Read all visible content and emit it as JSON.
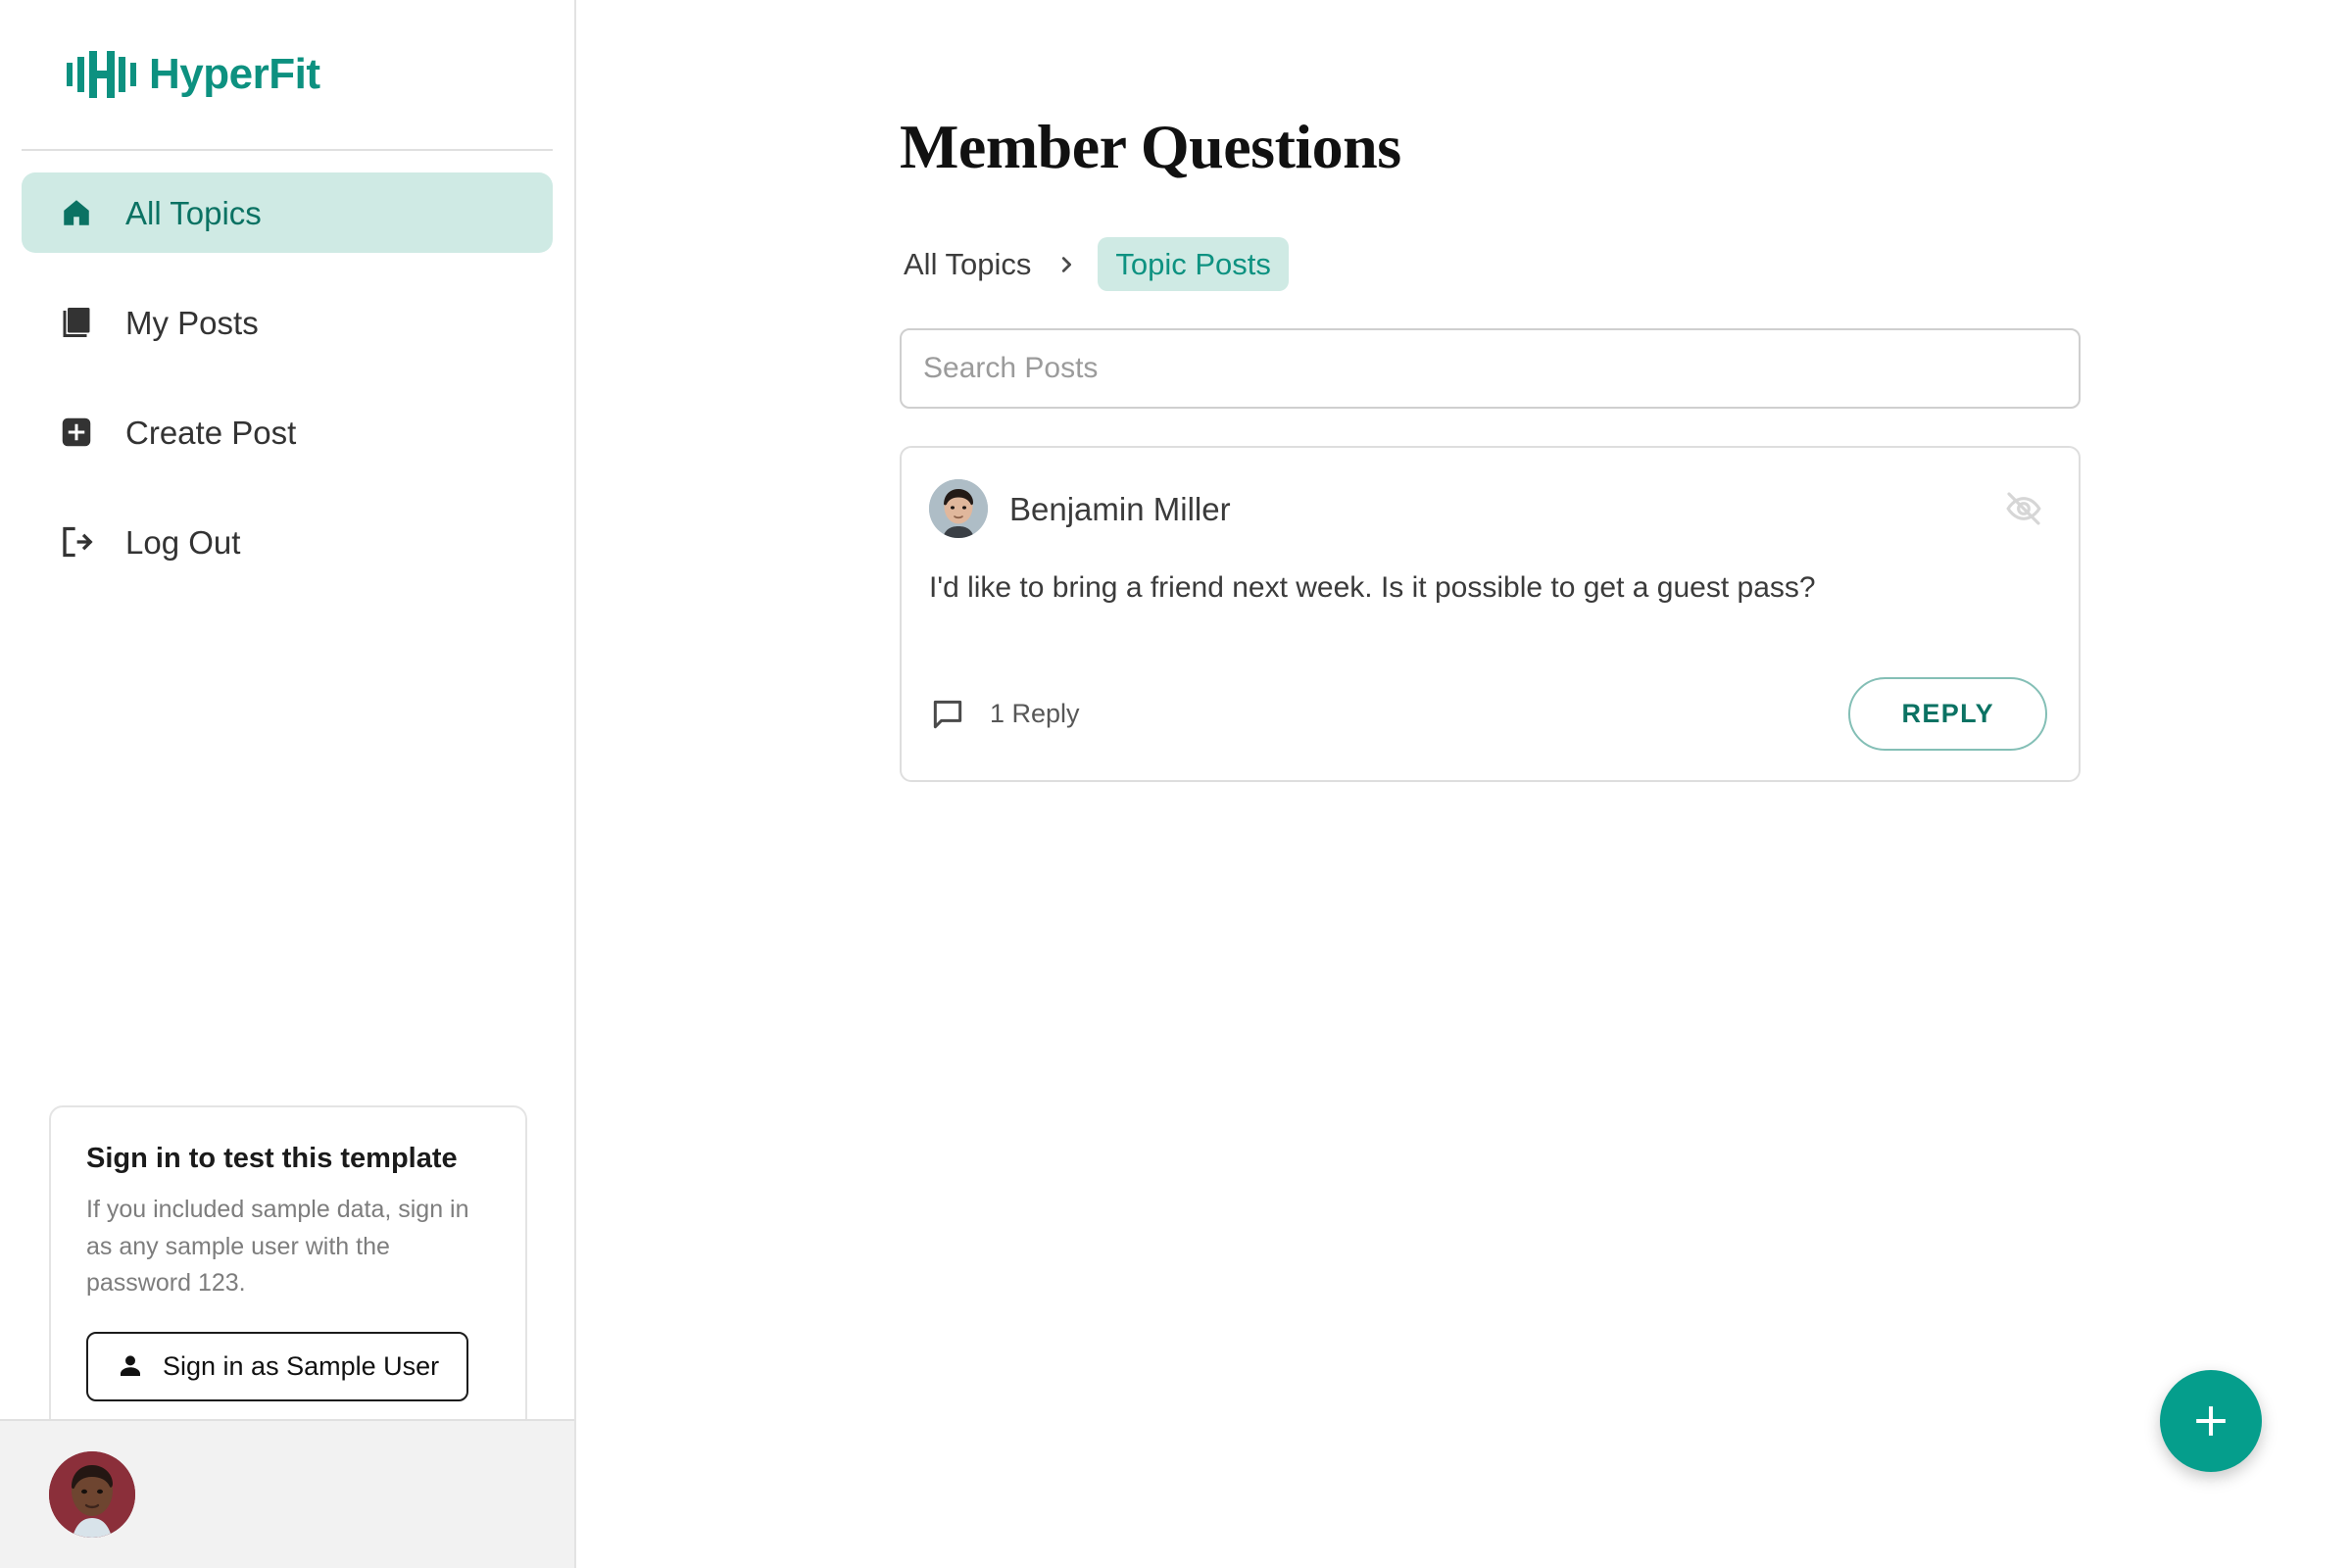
{
  "brand": {
    "name": "HyperFit",
    "logo_icon": "barbell-icon",
    "color": "#0d9180"
  },
  "sidebar": {
    "items": [
      {
        "label": "All Topics",
        "icon": "home-icon",
        "active": true
      },
      {
        "label": "My Posts",
        "icon": "library-books-icon",
        "active": false
      },
      {
        "label": "Create Post",
        "icon": "add-box-icon",
        "active": false
      },
      {
        "label": "Log Out",
        "icon": "logout-icon",
        "active": false
      }
    ],
    "signin_card": {
      "title": "Sign in to test this template",
      "description": "If you included sample data, sign in as any sample user with the password 123.",
      "button_label": "Sign in as Sample User",
      "button_icon": "person-icon"
    },
    "footer": {
      "avatar_name": "current-user-avatar"
    }
  },
  "main": {
    "title": "Member Questions",
    "breadcrumb": {
      "parent": "All Topics",
      "separator": "chevron-right-icon",
      "current": "Topic Posts"
    },
    "search": {
      "placeholder": "Search Posts",
      "value": ""
    },
    "posts": [
      {
        "author": "Benjamin Miller",
        "body": "I'd like to bring a friend next week. Is it possible to get a guest pass?",
        "reply_count_label": "1 Reply",
        "reply_button_label": "REPLY",
        "visibility_icon": "eye-off-icon",
        "comment_icon": "chat-bubble-icon"
      }
    ],
    "fab": {
      "icon": "plus-icon",
      "color": "#059e8c"
    }
  },
  "colors": {
    "accent": "#0b7263",
    "accent_light": "#cfeae4",
    "fab": "#059e8c"
  }
}
